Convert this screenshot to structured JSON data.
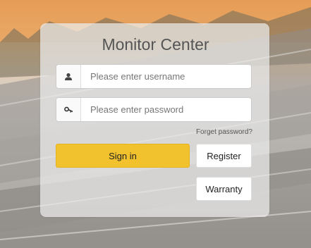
{
  "app": {
    "title": "Monitor Center"
  },
  "login": {
    "username_placeholder": "Please enter username",
    "username_value": "",
    "password_placeholder": "Please enter password",
    "password_value": "",
    "forget_password": "Forget password?",
    "sign_in_label": "Sign in",
    "register_label": "Register",
    "warranty_label": "Warranty"
  },
  "icons": {
    "username": "user-icon",
    "password": "key-icon"
  },
  "colors": {
    "sign_in_button": "#f2c12e",
    "card_background": "#ebebeb",
    "title_text": "#555555"
  }
}
